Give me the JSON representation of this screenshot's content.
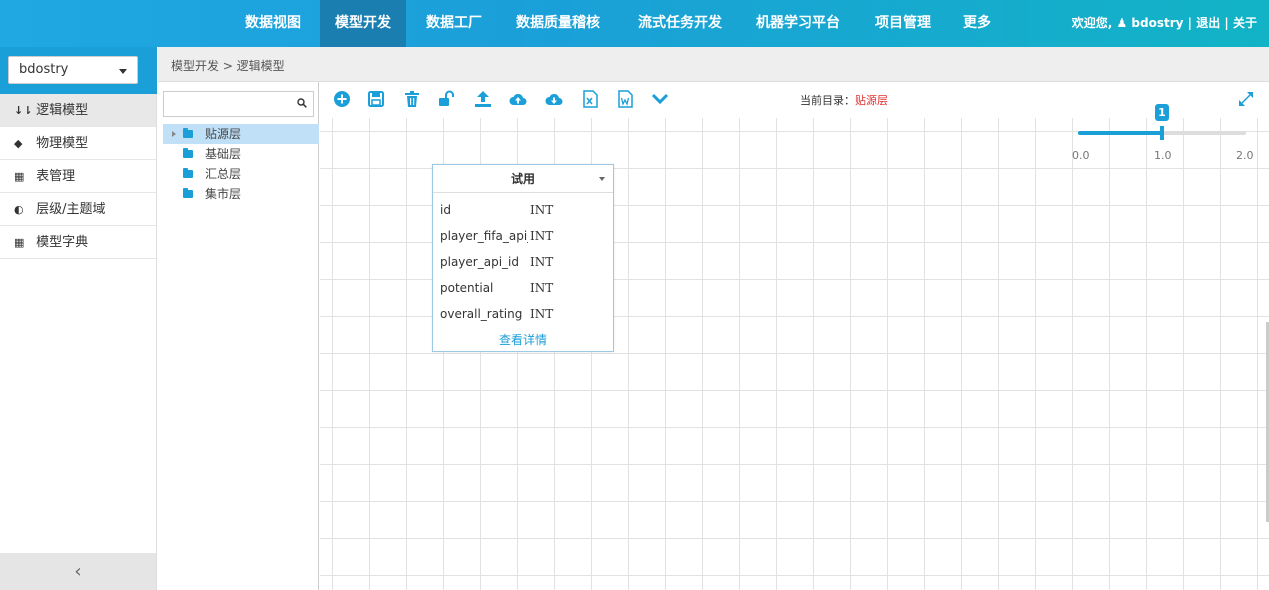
{
  "topnav": {
    "items": [
      {
        "label": "数据视图",
        "active": false
      },
      {
        "label": "模型开发",
        "active": true
      },
      {
        "label": "数据工厂",
        "active": false
      },
      {
        "label": "数据质量稽核",
        "active": false
      },
      {
        "label": "流式任务开发",
        "active": false
      },
      {
        "label": "机器学习平台",
        "active": false
      },
      {
        "label": "项目管理",
        "active": false
      },
      {
        "label": "更多",
        "active": false
      }
    ],
    "welcome": "欢迎您,",
    "username": "bdostry",
    "sep1": " | ",
    "logout": "退出",
    "sep2": " | ",
    "about": "关于"
  },
  "sidebar": {
    "project": "bdostry",
    "items": [
      {
        "label": "逻辑模型",
        "icon": "sort-icon",
        "glyph": "↓⇂",
        "active": true
      },
      {
        "label": "物理模型",
        "icon": "cube-icon",
        "glyph": "◆",
        "active": false
      },
      {
        "label": "表管理",
        "icon": "grid-icon",
        "glyph": "▦",
        "active": false
      },
      {
        "label": "层级/主题域",
        "icon": "layers-icon",
        "glyph": "◐",
        "active": false
      },
      {
        "label": "模型字典",
        "icon": "grid-icon",
        "glyph": "▦",
        "active": false
      }
    ],
    "collapse": "‹"
  },
  "breadcrumb": "模型开发 > 逻辑模型",
  "tree": {
    "search_placeholder": "",
    "nodes": [
      {
        "label": "贴源层",
        "selected": true,
        "has_children": true
      },
      {
        "label": "基础层",
        "selected": false,
        "has_children": false
      },
      {
        "label": "汇总层",
        "selected": false,
        "has_children": false
      },
      {
        "label": "集市层",
        "selected": false,
        "has_children": false
      }
    ]
  },
  "toolbar": {
    "icons": [
      "add-icon",
      "save-icon",
      "delete-icon",
      "unlock-icon",
      "upload-icon",
      "cloud-upload-icon",
      "cloud-download-icon",
      "excel-icon",
      "word-icon",
      "chevron-down-icon"
    ],
    "current_dir_label": "当前目录：",
    "current_dir_value": "贴源层",
    "accent": "#1b9fd9"
  },
  "zoom": {
    "value": "1",
    "fraction": 0.5,
    "ticks": [
      "0.0",
      "1.0",
      "2.0"
    ]
  },
  "entity": {
    "title": "试用",
    "fields": [
      {
        "name": "id",
        "type": "INT"
      },
      {
        "name": "player_fifa_api_id",
        "type": "INT"
      },
      {
        "name": "player_api_id",
        "type": "INT"
      },
      {
        "name": "potential",
        "type": "INT"
      },
      {
        "name": "overall_rating",
        "type": "INT"
      }
    ],
    "detail_link": "查看详情"
  }
}
